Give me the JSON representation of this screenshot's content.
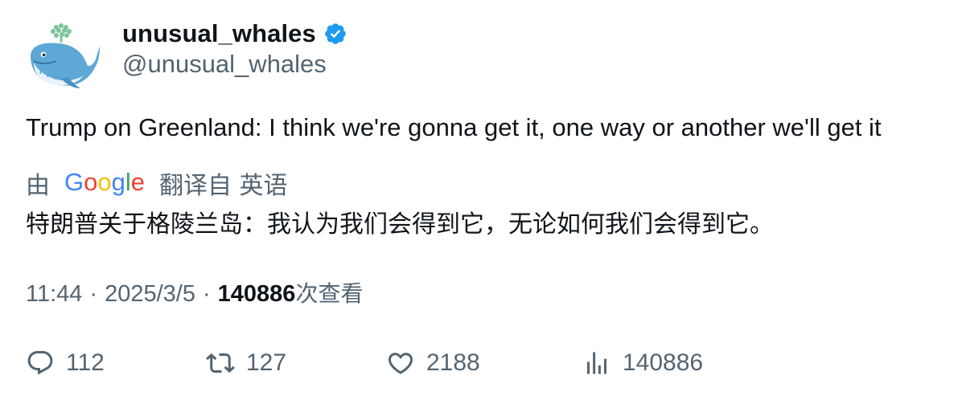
{
  "author": {
    "display_name": "unusual_whales",
    "handle": "@unusual_whales",
    "verified": true,
    "verified_color": "#1d9bf0",
    "avatar_icon": "whale-icon"
  },
  "tweet": {
    "text": "Trump on Greenland: I think we're gonna get it, one way or another we'll get it"
  },
  "translation": {
    "prefix": "由",
    "provider": "Google",
    "suffix": "翻译自 英语",
    "text": "特朗普关于格陵兰岛：我认为我们会得到它，无论如何我们会得到它。"
  },
  "meta": {
    "time": "11:44",
    "separator": "·",
    "date": "2025/3/5",
    "views_count": "140886",
    "views_label": "次查看"
  },
  "actions": {
    "replies": "112",
    "retweets": "127",
    "likes": "2188",
    "views": "140886"
  },
  "colors": {
    "text_primary": "#0f1419",
    "text_secondary": "#536471",
    "accent": "#1d9bf0"
  }
}
